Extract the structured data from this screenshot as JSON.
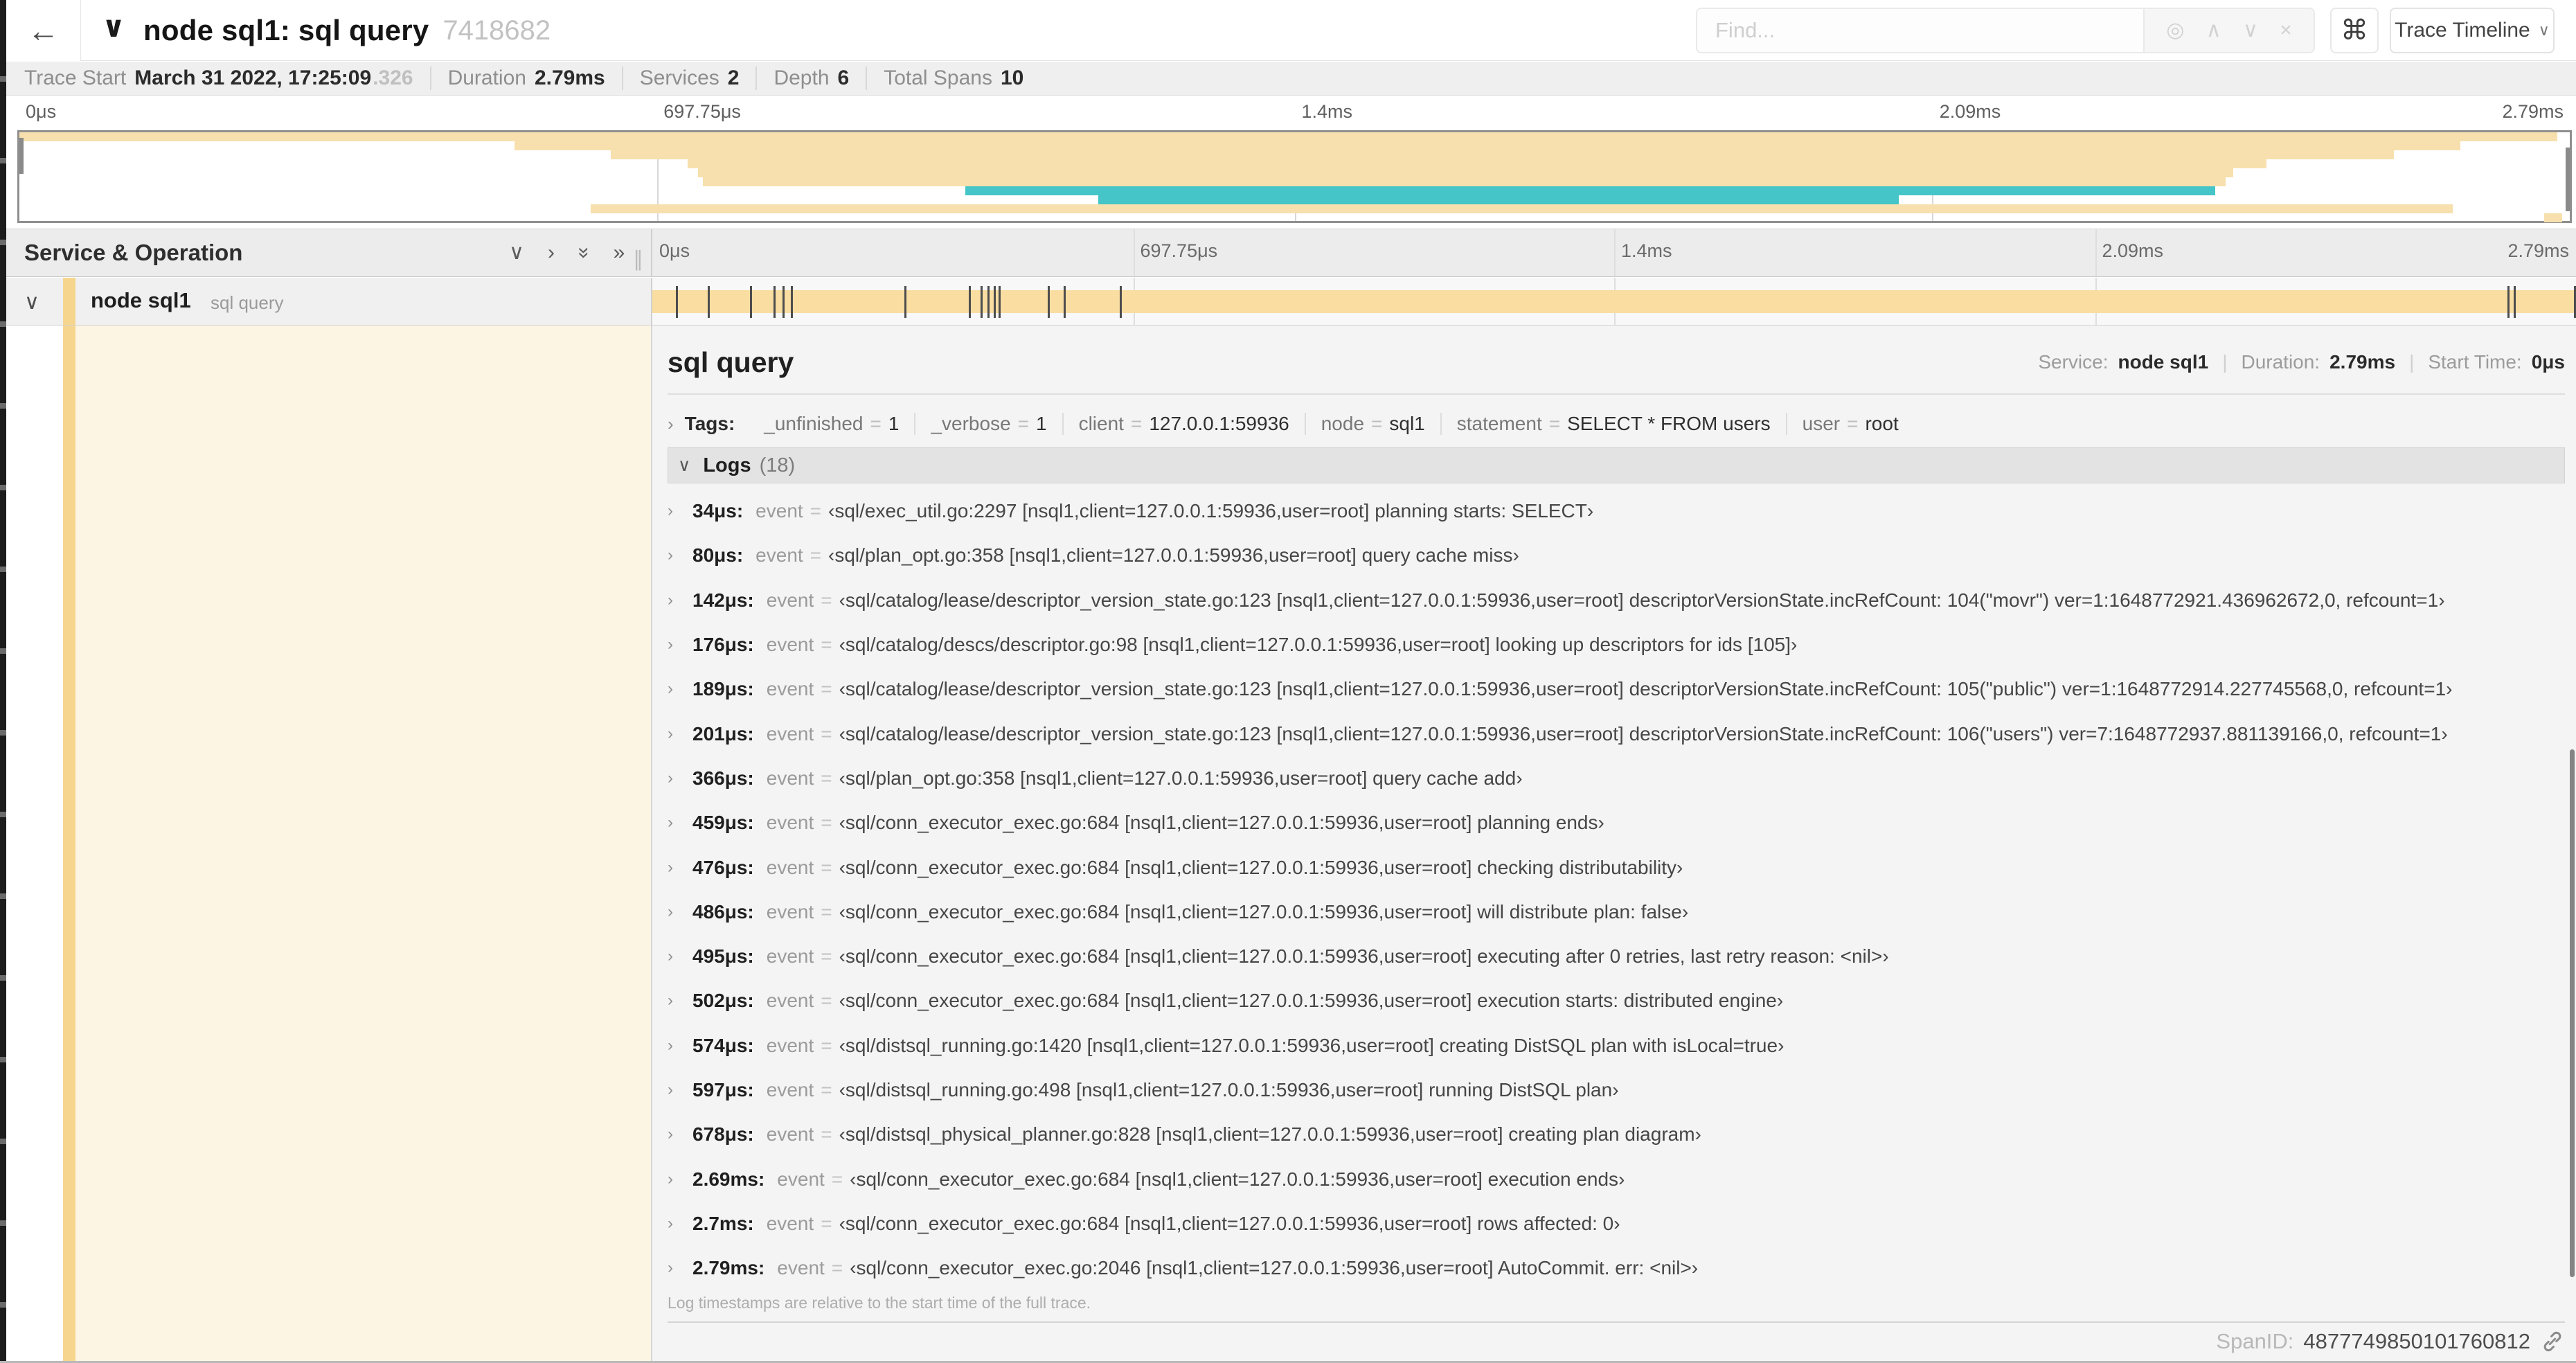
{
  "colors": {
    "tan": "#F7E0AD",
    "tan_bar": "#F9DDA1",
    "tan_accent": "#F6D68F",
    "teal": "#45C5C7",
    "cream": "#FDF5E3"
  },
  "header": {
    "back_icon": "←",
    "collapse_icon": "∨",
    "title": "node sql1: sql query",
    "trace_id": "7418682",
    "find_placeholder": "Find...",
    "tools": {
      "target": "◎",
      "prev": "∧",
      "next": "∨",
      "clear": "×"
    },
    "shortcut_icon": "⌘",
    "view_dropdown": "Trace Timeline",
    "dropdown_chevron": "∨"
  },
  "summary": {
    "trace_start_label": "Trace Start",
    "trace_start_value": "March 31 2022, 17:25:09",
    "trace_start_ms": ".326",
    "duration_label": "Duration",
    "duration_value": "2.79ms",
    "services_label": "Services",
    "services_value": "2",
    "depth_label": "Depth",
    "depth_value": "6",
    "spans_label": "Total Spans",
    "spans_value": "10"
  },
  "minimap": {
    "ticks": [
      {
        "label": "0μs",
        "pct": 0,
        "align": "left"
      },
      {
        "label": "697.75μs",
        "pct": 25,
        "align": "left"
      },
      {
        "label": "1.4ms",
        "pct": 50,
        "align": "left"
      },
      {
        "label": "2.09ms",
        "pct": 75,
        "align": "left"
      },
      {
        "label": "2.79ms",
        "pct": 100,
        "align": "right"
      }
    ],
    "grid_pcts": [
      25,
      50,
      75
    ],
    "rows": [
      {
        "row": 0,
        "start": 0,
        "end": 99.5,
        "color": "tan"
      },
      {
        "row": 1,
        "start": 19.4,
        "end": 95.7,
        "color": "tan"
      },
      {
        "row": 2,
        "start": 23.2,
        "end": 93.1,
        "color": "tan"
      },
      {
        "row": 3,
        "start": 26.2,
        "end": 88.1,
        "color": "tan"
      },
      {
        "row": 4,
        "start": 26.6,
        "end": 86.8,
        "color": "tan"
      },
      {
        "row": 5,
        "start": 26.8,
        "end": 86.5,
        "color": "tan"
      },
      {
        "row": 6,
        "start": 37.1,
        "end": 86.1,
        "color": "teal"
      },
      {
        "row": 7,
        "start": 42.3,
        "end": 73.7,
        "color": "teal"
      },
      {
        "row": 8,
        "start": 22.4,
        "end": 95.4,
        "color": "tan"
      },
      {
        "row": 9,
        "start": 99.0,
        "end": 99.7,
        "color": "tan"
      }
    ]
  },
  "timeline": {
    "header": "Service & Operation",
    "icons": {
      "collapse_one": "∨",
      "expand_one": "›",
      "collapse_all": "»",
      "expand_all": "»"
    },
    "resizer": "∥",
    "ruler_ticks": [
      {
        "label": "0μs",
        "pct": 0,
        "align": "left"
      },
      {
        "label": "697.75μs",
        "pct": 25,
        "align": "left"
      },
      {
        "label": "1.4ms",
        "pct": 50,
        "align": "left"
      },
      {
        "label": "2.09ms",
        "pct": 75,
        "align": "left"
      },
      {
        "label": "2.79ms",
        "pct": 100,
        "align": "right"
      }
    ],
    "grid_pcts": [
      25,
      50,
      75
    ]
  },
  "span_row": {
    "chevron": "∨",
    "service": "node sql1",
    "operation": "sql query",
    "log_tick_pcts": [
      1.22,
      2.87,
      5.09,
      6.31,
      6.77,
      7.2,
      13.12,
      16.45,
      17.06,
      17.42,
      17.74,
      17.99,
      20.57,
      21.4,
      24.3,
      96.42,
      96.77,
      99.9
    ]
  },
  "detail": {
    "title": "sql query",
    "service_label": "Service:",
    "service_value": "node sql1",
    "duration_label": "Duration:",
    "duration_value": "2.79ms",
    "start_label": "Start Time:",
    "start_value": "0μs",
    "meta_sep": "|",
    "tags_chevron": "›",
    "tags_label": "Tags:",
    "tag_eq": "=",
    "tags": [
      {
        "key": "_unfinished",
        "value": "1"
      },
      {
        "key": "_verbose",
        "value": "1"
      },
      {
        "key": "client",
        "value": "127.0.0.1:59936"
      },
      {
        "key": "node",
        "value": "sql1"
      },
      {
        "key": "statement",
        "value": "SELECT * FROM users"
      },
      {
        "key": "user",
        "value": "root"
      }
    ],
    "logs_chevron": "∨",
    "logs_label": "Logs",
    "logs_count": "(18)",
    "log_chevron": "›",
    "log_event_label": "event",
    "log_eq": "=",
    "logs": [
      {
        "time": "34μs:",
        "value": "‹sql/exec_util.go:2297 [nsql1,client=127.0.0.1:59936,user=root] planning starts: SELECT›"
      },
      {
        "time": "80μs:",
        "value": "‹sql/plan_opt.go:358 [nsql1,client=127.0.0.1:59936,user=root] query cache miss›"
      },
      {
        "time": "142μs:",
        "value": "‹sql/catalog/lease/descriptor_version_state.go:123 [nsql1,client=127.0.0.1:59936,user=root] descriptorVersionState.incRefCount: 104(\"movr\") ver=1:1648772921.436962672,0, refcount=1›"
      },
      {
        "time": "176μs:",
        "value": "‹sql/catalog/descs/descriptor.go:98 [nsql1,client=127.0.0.1:59936,user=root] looking up descriptors for ids [105]›"
      },
      {
        "time": "189μs:",
        "value": "‹sql/catalog/lease/descriptor_version_state.go:123 [nsql1,client=127.0.0.1:59936,user=root] descriptorVersionState.incRefCount: 105(\"public\") ver=1:1648772914.227745568,0, refcount=1›"
      },
      {
        "time": "201μs:",
        "value": "‹sql/catalog/lease/descriptor_version_state.go:123 [nsql1,client=127.0.0.1:59936,user=root] descriptorVersionState.incRefCount: 106(\"users\") ver=7:1648772937.881139166,0, refcount=1›"
      },
      {
        "time": "366μs:",
        "value": "‹sql/plan_opt.go:358 [nsql1,client=127.0.0.1:59936,user=root] query cache add›"
      },
      {
        "time": "459μs:",
        "value": "‹sql/conn_executor_exec.go:684 [nsql1,client=127.0.0.1:59936,user=root] planning ends›"
      },
      {
        "time": "476μs:",
        "value": "‹sql/conn_executor_exec.go:684 [nsql1,client=127.0.0.1:59936,user=root] checking distributability›"
      },
      {
        "time": "486μs:",
        "value": "‹sql/conn_executor_exec.go:684 [nsql1,client=127.0.0.1:59936,user=root] will distribute plan: false›"
      },
      {
        "time": "495μs:",
        "value": "‹sql/conn_executor_exec.go:684 [nsql1,client=127.0.0.1:59936,user=root] executing after 0 retries, last retry reason: <nil>›"
      },
      {
        "time": "502μs:",
        "value": "‹sql/conn_executor_exec.go:684 [nsql1,client=127.0.0.1:59936,user=root] execution starts: distributed engine›"
      },
      {
        "time": "574μs:",
        "value": "‹sql/distsql_running.go:1420 [nsql1,client=127.0.0.1:59936,user=root] creating DistSQL plan with isLocal=true›"
      },
      {
        "time": "597μs:",
        "value": "‹sql/distsql_running.go:498 [nsql1,client=127.0.0.1:59936,user=root] running DistSQL plan›"
      },
      {
        "time": "678μs:",
        "value": "‹sql/distsql_physical_planner.go:828 [nsql1,client=127.0.0.1:59936,user=root] creating plan diagram›"
      },
      {
        "time": "2.69ms:",
        "value": "‹sql/conn_executor_exec.go:684 [nsql1,client=127.0.0.1:59936,user=root] execution ends›"
      },
      {
        "time": "2.7ms:",
        "value": "‹sql/conn_executor_exec.go:684 [nsql1,client=127.0.0.1:59936,user=root] rows affected: 0›"
      },
      {
        "time": "2.79ms:",
        "value": "‹sql/conn_executor_exec.go:2046 [nsql1,client=127.0.0.1:59936,user=root] AutoCommit. err: <nil>›"
      }
    ],
    "footer": "Log timestamps are relative to the start time of the full trace.",
    "spanid_label": "SpanID:",
    "spanid_value": "4877749850101760812"
  }
}
